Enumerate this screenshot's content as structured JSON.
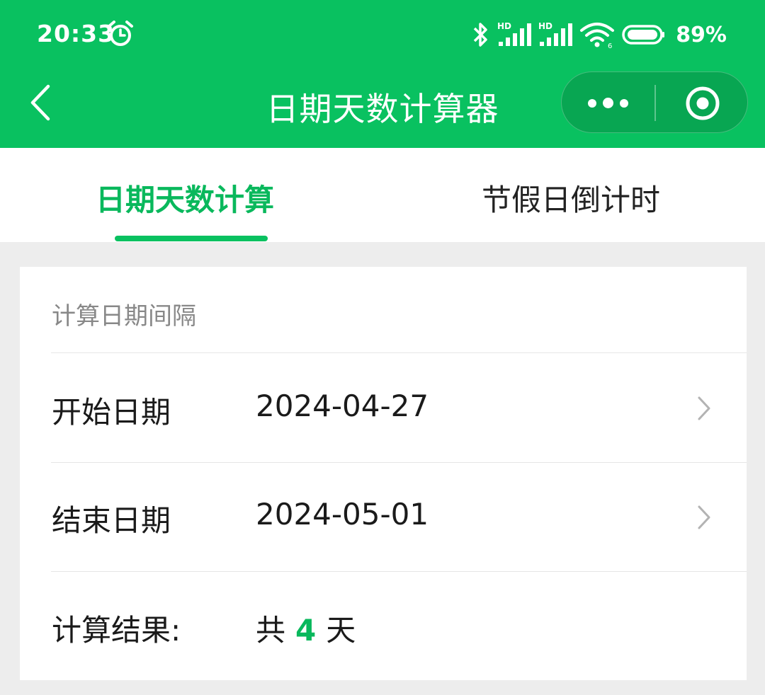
{
  "status_bar": {
    "time": "20:33",
    "battery": "89%",
    "icons": [
      "alarm-icon",
      "bluetooth-icon",
      "signal-hd-icon",
      "signal-hd-icon",
      "wifi-icon",
      "battery-icon"
    ]
  },
  "nav": {
    "title": "日期天数计算器",
    "icons": [
      "back-arrow-icon",
      "more-dots-icon",
      "close-target-icon"
    ]
  },
  "tabs": [
    {
      "label": "日期天数计算",
      "active": true
    },
    {
      "label": "节假日倒计时",
      "active": false
    }
  ],
  "card": {
    "title": "计算日期间隔",
    "start": {
      "label": "开始日期",
      "value": "2024-04-27"
    },
    "end": {
      "label": "结束日期",
      "value": "2024-05-01"
    },
    "result": {
      "label": "计算结果:",
      "prefix": "共",
      "days": "4",
      "suffix": "天"
    }
  },
  "colors": {
    "brand_green": "#09c160",
    "active_text": "#09b85c",
    "background": "#ededed"
  }
}
